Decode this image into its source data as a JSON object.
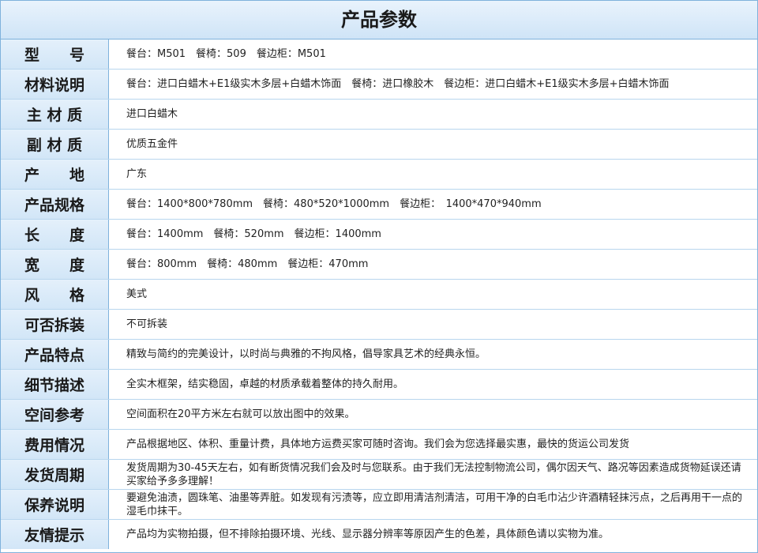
{
  "title": "产品参数",
  "rows": [
    {
      "label": "型　　号",
      "value": "餐台：M501　餐椅：509　餐边柜：M501"
    },
    {
      "label": "材料说明",
      "value": "餐台：进口白蜡木+E1级实木多层+白蜡木饰面　餐椅：进口橡胶木　餐边柜：进口白蜡木+E1级实木多层+白蜡木饰面"
    },
    {
      "label": "主 材 质",
      "value": "进口白蜡木"
    },
    {
      "label": "副 材 质",
      "value": "优质五金件"
    },
    {
      "label": "产　　地",
      "value": "广东"
    },
    {
      "label": "产品规格",
      "value": "餐台：1400*800*780mm　餐椅：480*520*1000mm　餐边柜：　1400*470*940mm"
    },
    {
      "label": "长　　度",
      "value": "餐台：1400mm　餐椅：520mm　餐边柜：1400mm"
    },
    {
      "label": "宽　　度",
      "value": "餐台：800mm　餐椅：480mm　餐边柜：470mm"
    },
    {
      "label": "风　　格",
      "value": "美式"
    },
    {
      "label": "可否拆装",
      "value": "不可拆装"
    },
    {
      "label": "产品特点",
      "value": "精致与简约的完美设计，以时尚与典雅的不拘风格，倡导家具艺术的经典永恒。"
    },
    {
      "label": "细节描述",
      "value": "全实木框架，结实稳固，卓越的材质承载着整体的持久耐用。"
    },
    {
      "label": "空间参考",
      "value": "空间面积在20平方米左右就可以放出图中的效果。"
    },
    {
      "label": "费用情况",
      "value": "产品根据地区、体积、重量计费，具体地方运费买家可随时咨询。我们会为您选择最实惠，最快的货运公司发货"
    },
    {
      "label": "发货周期",
      "value": "发货周期为30-45天左右，如有断货情况我们会及时与您联系。由于我们无法控制物流公司，偶尔因天气、路况等因素造成货物延误还请买家给予多多理解！"
    },
    {
      "label": "保养说明",
      "value": "要避免油渍，圆珠笔、油墨等弄脏。如发现有污渍等，应立即用清洁剂清洁，可用干净的白毛巾沾少许酒精轻抹污点，之后再用干一点的湿毛巾抹干。"
    },
    {
      "label": "友情提示",
      "value": "产品均为实物拍摄，但不排除拍摄环境、光线、显示器分辨率等原因产生的色差，具体颜色请以实物为准。"
    }
  ]
}
